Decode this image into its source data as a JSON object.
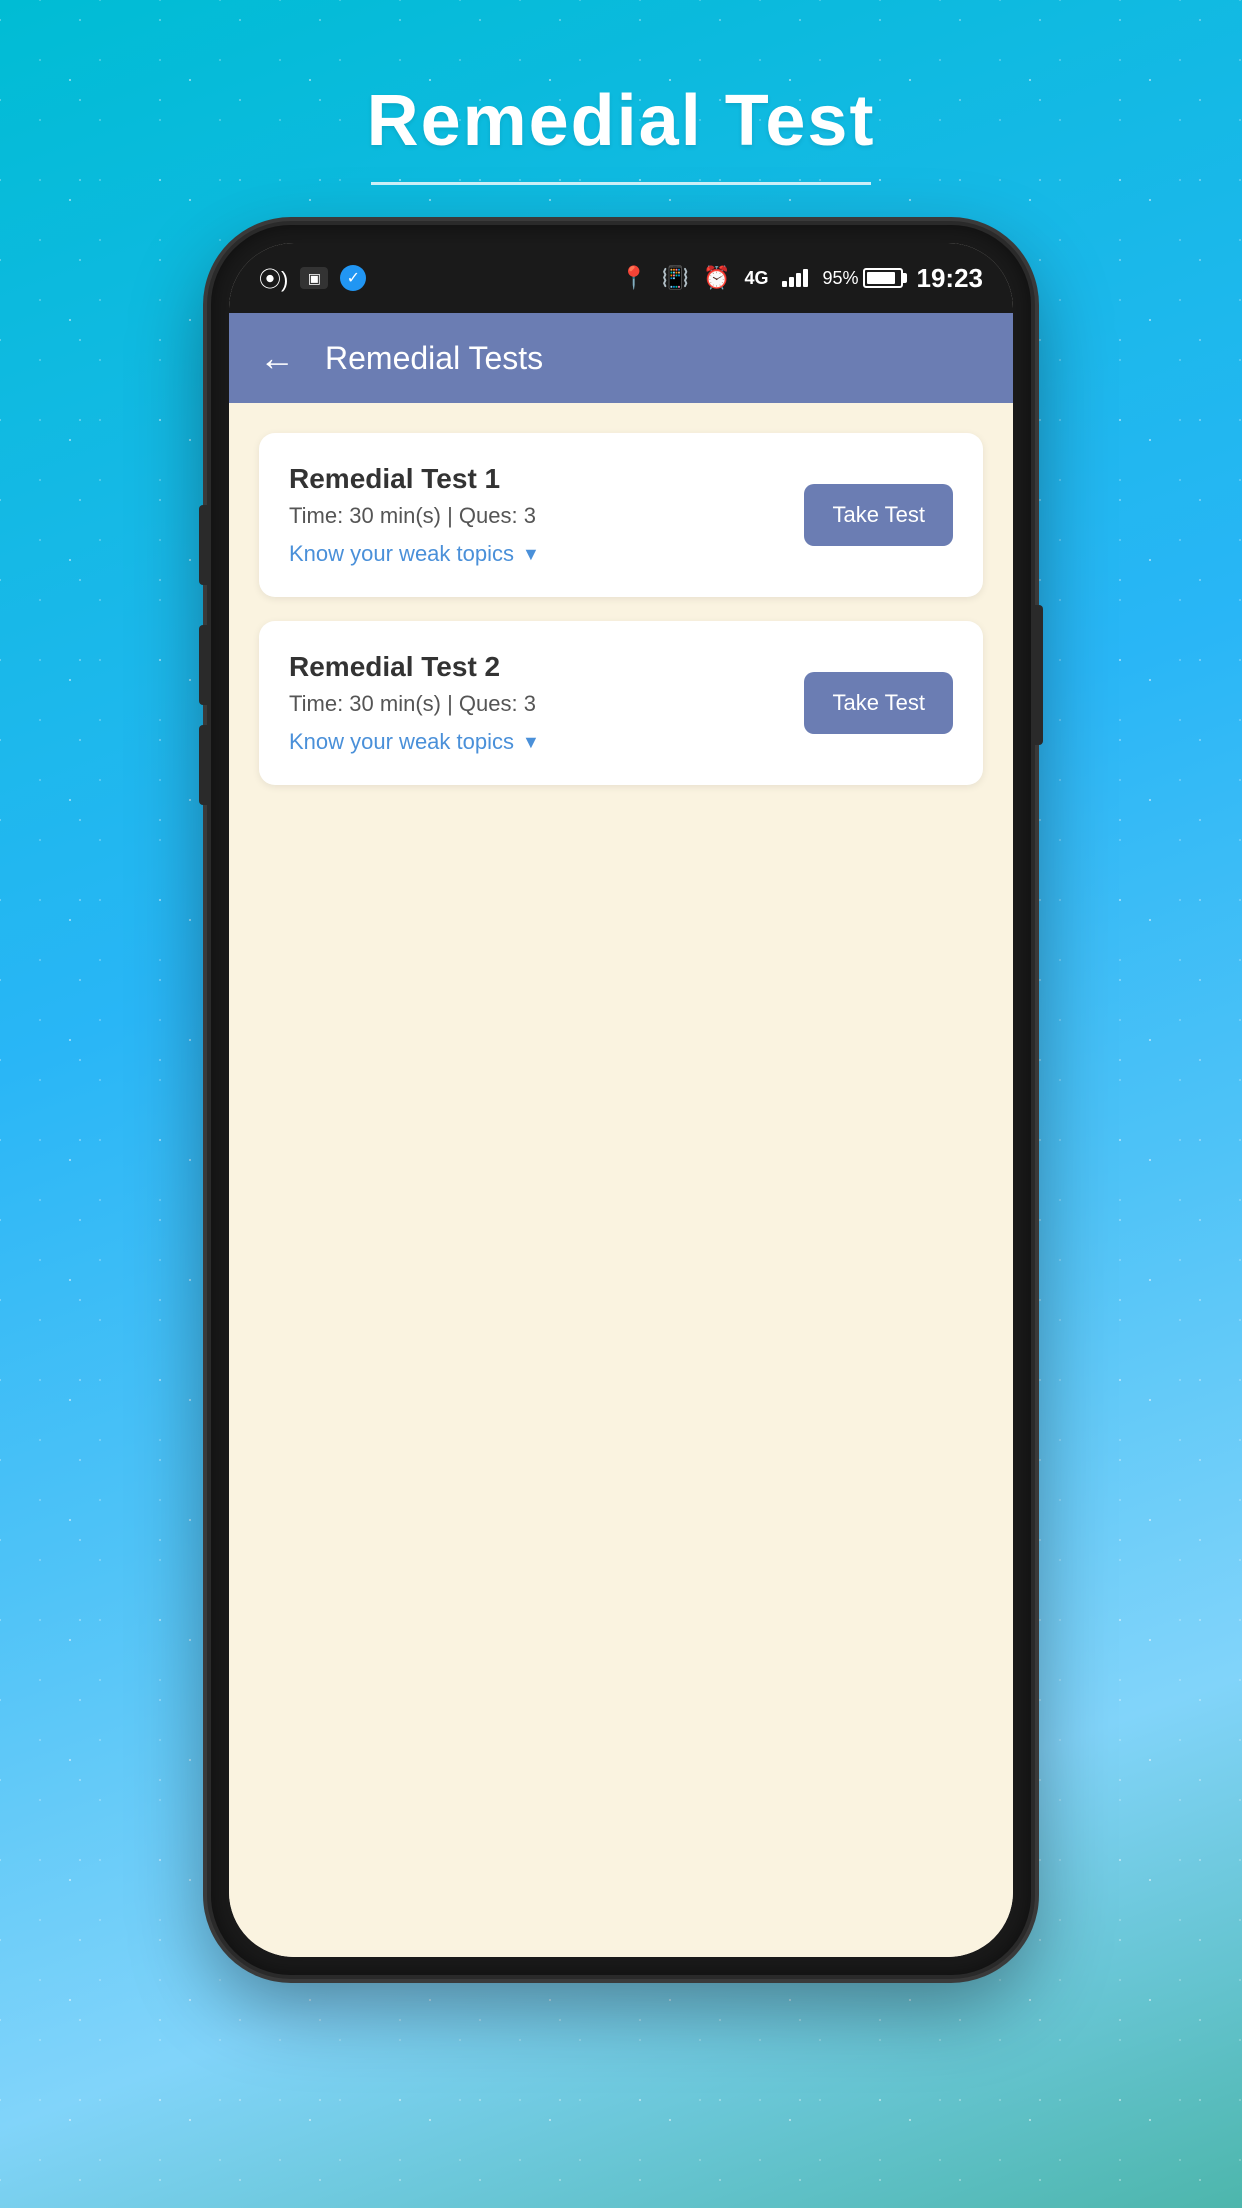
{
  "page": {
    "title": "Remedial Test",
    "background_color": "#29b6f6"
  },
  "status_bar": {
    "time": "19:23",
    "battery_percent": "95%",
    "network": "4G"
  },
  "nav_bar": {
    "title": "Remedial Tests",
    "back_label": "←"
  },
  "tests": [
    {
      "id": 1,
      "name": "Remedial Test 1",
      "time": "Time: 30 min(s) | Ques: 3",
      "weak_topics_label": "Know your weak topics",
      "take_test_label": "Take Test"
    },
    {
      "id": 2,
      "name": "Remedial Test 2",
      "time": "Time: 30 min(s) | Ques: 3",
      "weak_topics_label": "Know your weak topics",
      "take_test_label": "Take Test"
    }
  ]
}
